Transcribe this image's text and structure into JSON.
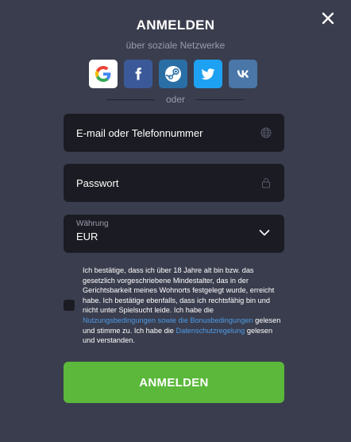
{
  "header": {
    "title": "ANMELDEN",
    "subtitle": "über soziale Netzwerke",
    "close_icon": "close-icon"
  },
  "socials": [
    {
      "name": "google",
      "icon": "google-icon",
      "bg": "#ffffff"
    },
    {
      "name": "facebook",
      "icon": "facebook-icon",
      "bg": "#3b5998"
    },
    {
      "name": "steam",
      "icon": "steam-icon",
      "bg": "#2a6ea6"
    },
    {
      "name": "twitter",
      "icon": "twitter-icon",
      "bg": "#1da1f2"
    },
    {
      "name": "vk",
      "icon": "vk-icon",
      "bg": "#4a76a8"
    }
  ],
  "divider": {
    "text": "oder"
  },
  "form": {
    "email": {
      "placeholder": "E-mail oder Telefonnummer",
      "value": "",
      "icon": "globe-icon"
    },
    "password": {
      "placeholder": "Passwort",
      "value": "",
      "icon": "lock-icon"
    },
    "currency": {
      "label": "Währung",
      "value": "EUR",
      "icon": "chevron-down-icon"
    }
  },
  "terms": {
    "checked": false,
    "text_1": "Ich bestätige, dass ich über 18 Jahre alt bin bzw. das gesetzlich vorgeschriebene Mindestalter, das in der Gerichtsbarkeit meines Wohnorts festgelegt wurde, erreicht habe. Ich bestätige ebenfalls, dass ich rechtsfähig bin und nicht unter Spielsucht leide. Ich habe die ",
    "link_1": "Nutzungsbedingungen sowie die Bonusbedingungen",
    "text_2": " gelesen und stimme zu. Ich habe die ",
    "link_2": "Datenschutzregelung",
    "text_3": " gelesen und verstanden."
  },
  "submit": {
    "label": "ANMELDEN"
  },
  "colors": {
    "background": "#3a3d4d",
    "field": "#1b1c23",
    "accent": "#5bb83b",
    "link": "#4d9be8"
  }
}
